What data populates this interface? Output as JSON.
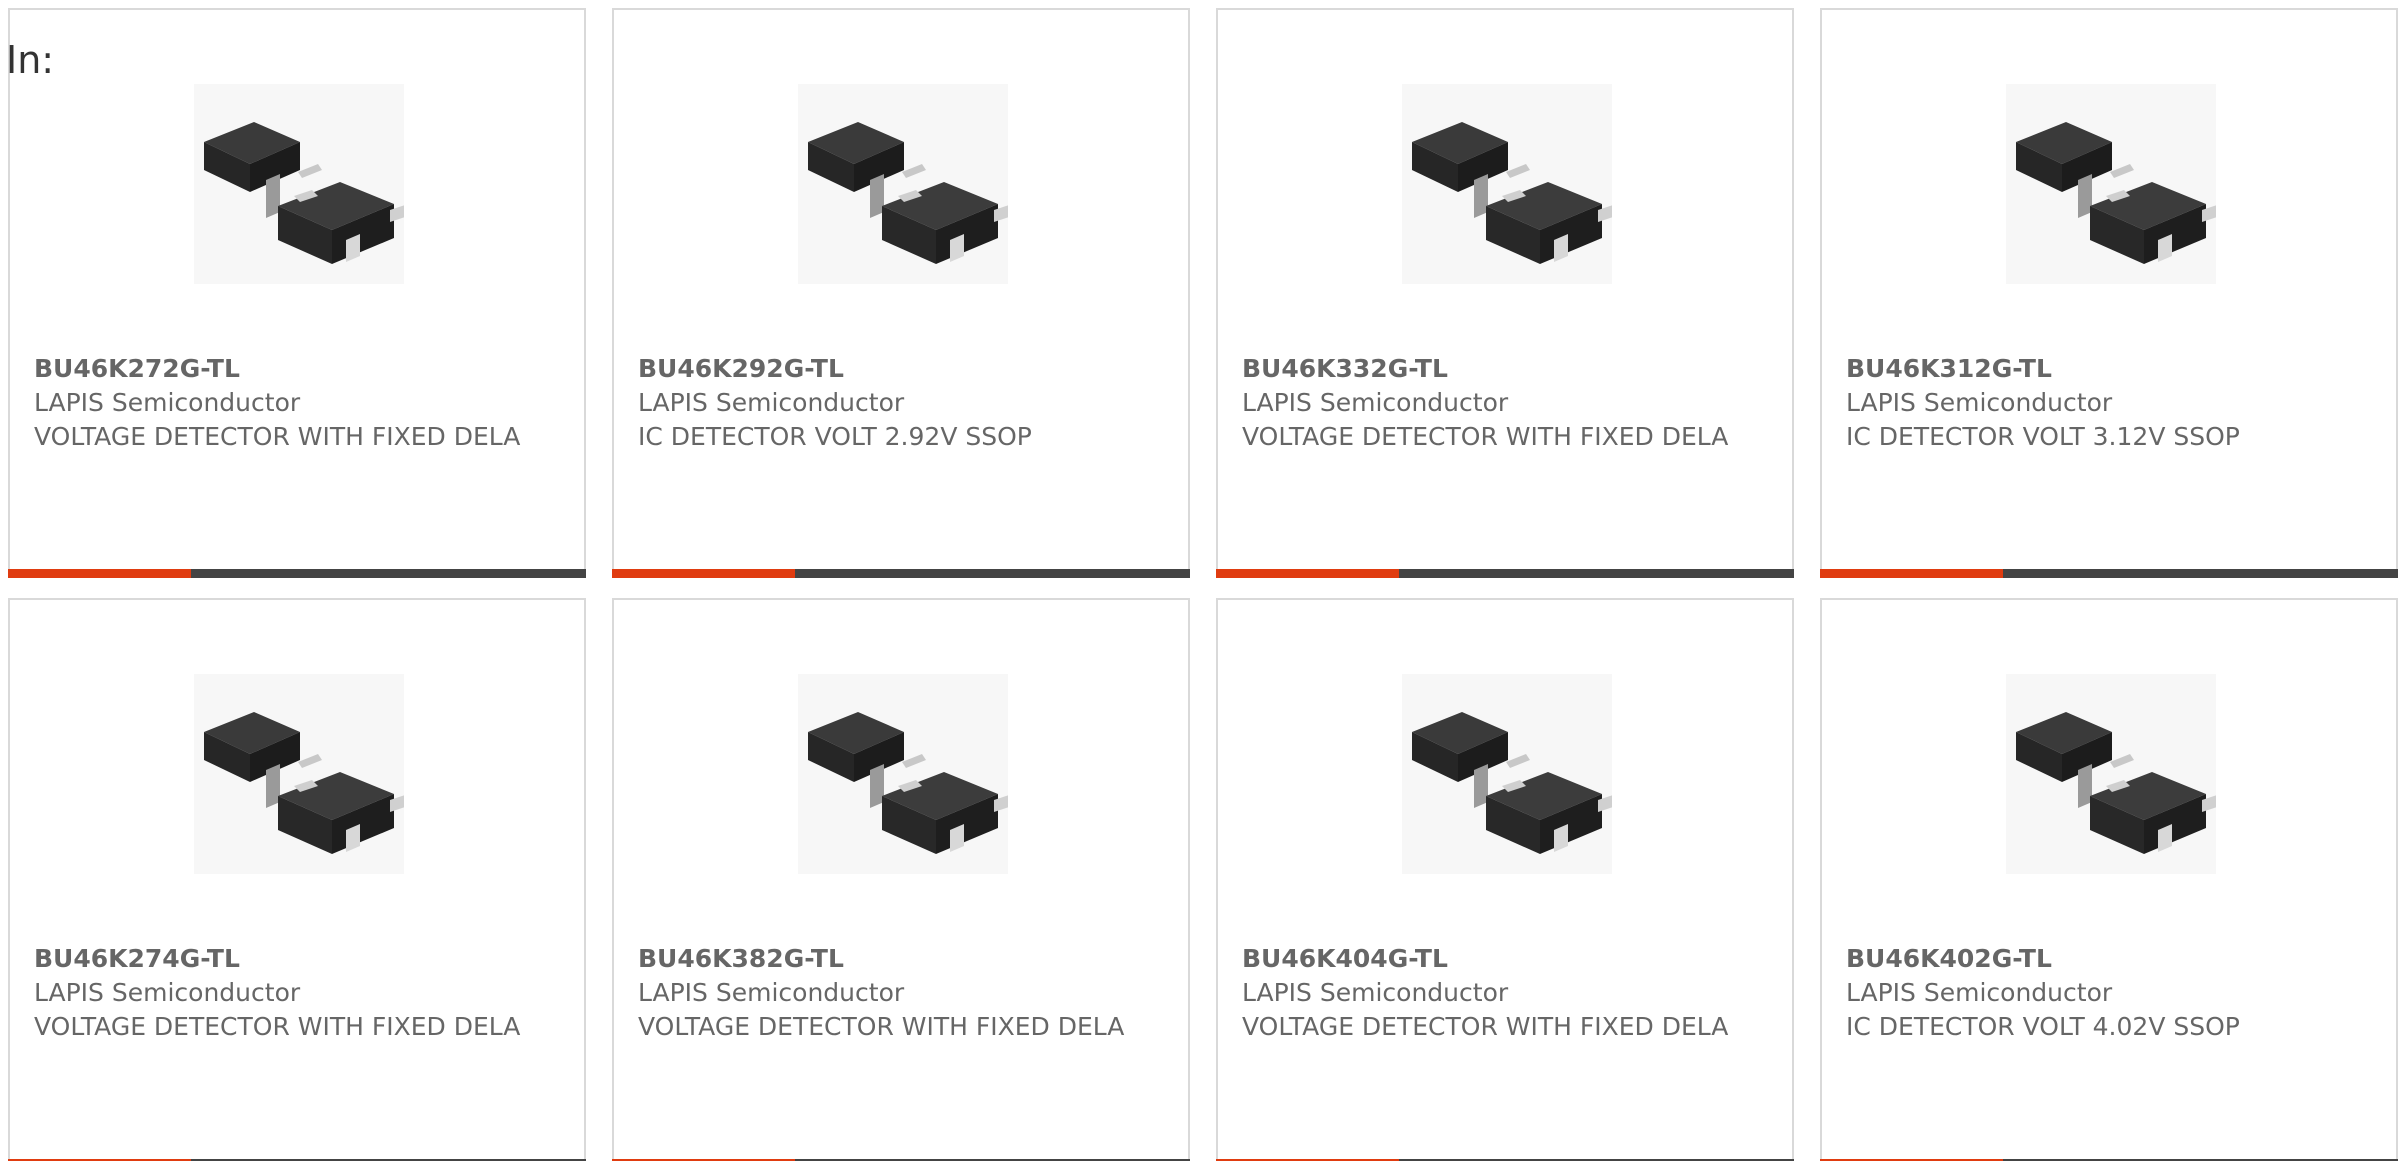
{
  "in_label": "In:",
  "colors": {
    "accent": "#e03c10",
    "bar": "#444444",
    "text": "#666666",
    "border": "#d9d9d9"
  },
  "products": [
    {
      "part": "BU46K272G-TL",
      "manufacturer": "LAPIS Semiconductor",
      "description": "VOLTAGE DETECTOR WITH FIXED DELA",
      "image_icon": "sot-package-icon"
    },
    {
      "part": "BU46K292G-TL",
      "manufacturer": "LAPIS Semiconductor",
      "description": "IC DETECTOR VOLT 2.92V SSOP",
      "image_icon": "sot-package-icon"
    },
    {
      "part": "BU46K332G-TL",
      "manufacturer": "LAPIS Semiconductor",
      "description": "VOLTAGE DETECTOR WITH FIXED DELA",
      "image_icon": "sot-package-icon"
    },
    {
      "part": "BU46K312G-TL",
      "manufacturer": "LAPIS Semiconductor",
      "description": "IC DETECTOR VOLT 3.12V SSOP",
      "image_icon": "sot-package-icon"
    },
    {
      "part": "BU46K274G-TL",
      "manufacturer": "LAPIS Semiconductor",
      "description": "VOLTAGE DETECTOR WITH FIXED DELA",
      "image_icon": "sot-package-icon"
    },
    {
      "part": "BU46K382G-TL",
      "manufacturer": "LAPIS Semiconductor",
      "description": "VOLTAGE DETECTOR WITH FIXED DELA",
      "image_icon": "sot-package-icon"
    },
    {
      "part": "BU46K404G-TL",
      "manufacturer": "LAPIS Semiconductor",
      "description": "VOLTAGE DETECTOR WITH FIXED DELA",
      "image_icon": "sot-package-icon"
    },
    {
      "part": "BU46K402G-TL",
      "manufacturer": "LAPIS Semiconductor",
      "description": "IC DETECTOR VOLT 4.02V SSOP",
      "image_icon": "sot-package-icon"
    }
  ]
}
